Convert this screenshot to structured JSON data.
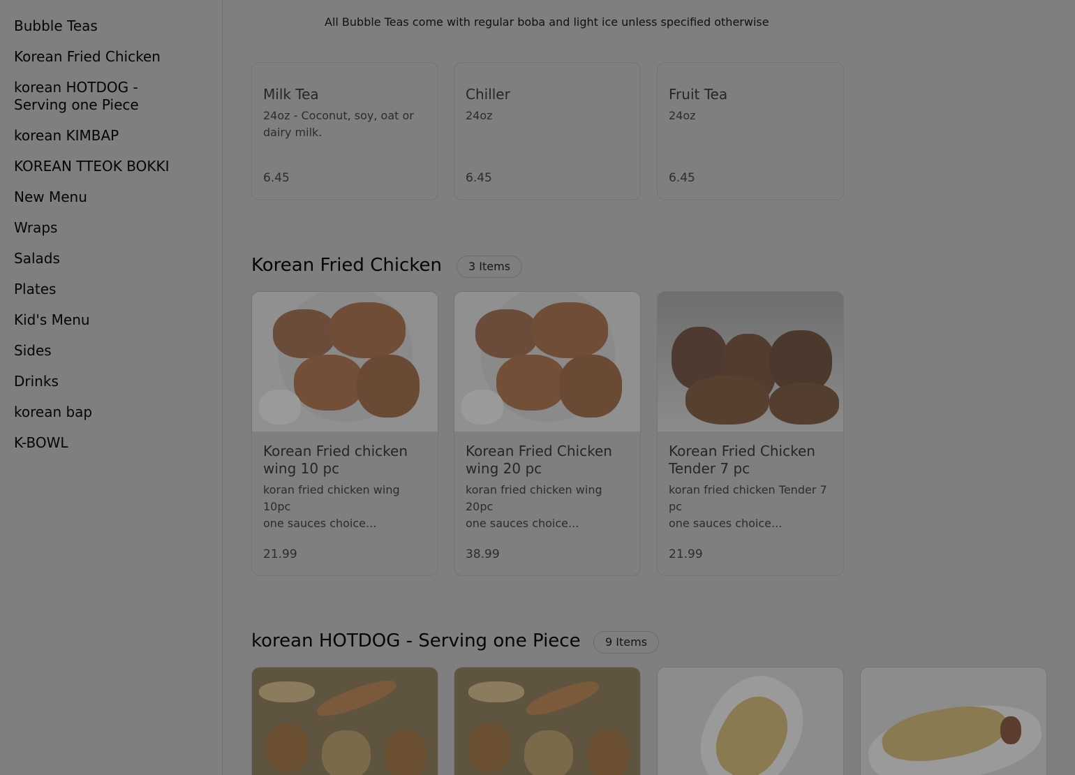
{
  "sidebar": {
    "items": [
      {
        "label": "Bubble Teas"
      },
      {
        "label": "Korean Fried Chicken"
      },
      {
        "label": "korean HOTDOG -\nServing one Piece"
      },
      {
        "label": "korean KIMBAP"
      },
      {
        "label": "KOREAN TTEOK BOKKI"
      },
      {
        "label": "New Menu"
      },
      {
        "label": "Wraps"
      },
      {
        "label": "Salads"
      },
      {
        "label": "Plates"
      },
      {
        "label": "Kid's Menu"
      },
      {
        "label": "Sides"
      },
      {
        "label": "Drinks"
      },
      {
        "label": "korean bap"
      },
      {
        "label": "K-BOWL"
      }
    ]
  },
  "bubble_teas": {
    "notice": "All Bubble Teas come with regular boba and light ice unless specified otherwise",
    "items": [
      {
        "title": "Milk Tea",
        "desc": "24oz - Coconut, soy, oat or\ndairy milk.",
        "price": "6.45"
      },
      {
        "title": "Chiller",
        "desc": "24oz",
        "price": "6.45"
      },
      {
        "title": "Fruit Tea",
        "desc": "24oz",
        "price": "6.45"
      }
    ]
  },
  "fried_chicken": {
    "title": "Korean Fried Chicken",
    "count": "3 Items",
    "items": [
      {
        "title": "Korean Fried chicken\nwing 10 pc",
        "desc": "koran fried chicken wing\n10pc\none sauces choice...",
        "price": "21.99",
        "image": "fried-chicken-wings-photo"
      },
      {
        "title": "Korean Fried Chicken\nwing 20 pc",
        "desc": "koran fried chicken wing\n20pc\none sauces choice...",
        "price": "38.99",
        "image": "fried-chicken-wings-photo"
      },
      {
        "title": "Korean Fried Chicken\nTender 7 pc",
        "desc": "koran fried chicken Tender 7\npc\none sauces choice...",
        "price": "21.99",
        "image": "fried-chicken-tenders-photo"
      }
    ]
  },
  "hotdog": {
    "title": "korean HOTDOG - Serving one Piece",
    "count": "9 Items"
  }
}
